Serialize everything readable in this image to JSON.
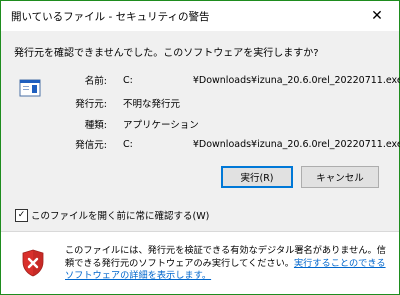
{
  "window": {
    "title": "開いているファイル - セキュリティの警告",
    "close_glyph": "✕"
  },
  "question": "発行元を確認できませんでした。このソフトウェアを実行しますか?",
  "fields": [
    {
      "label": "名前:",
      "value_prefix": "C:",
      "value_suffix": "¥Downloads¥izuna_20.6.0rel_20220711.exe"
    },
    {
      "label": "発行元:",
      "value": "不明な発行元"
    },
    {
      "label": "種類:",
      "value": "アプリケーション"
    },
    {
      "label": "発信元:",
      "value_prefix": "C:",
      "value_suffix": "¥Downloads¥izuna_20.6.0rel_20220711.exe"
    }
  ],
  "buttons": {
    "run": "実行(R)",
    "cancel": "キャンセル"
  },
  "checkbox": {
    "label": "このファイルを開く前に常に確認する(W)",
    "checked": true
  },
  "warning": {
    "text": "このファイルには、発行元を検証できる有効なデジタル署名がありません。信頼できる発行元のソフトウェアのみ実行してください。",
    "link": "実行することのできるソフトウェアの詳細を表示します。"
  },
  "colors": {
    "window_border": "#1e8c1e",
    "accent": "#0078d7",
    "link": "#0066cc",
    "shield_red": "#d9302c"
  }
}
